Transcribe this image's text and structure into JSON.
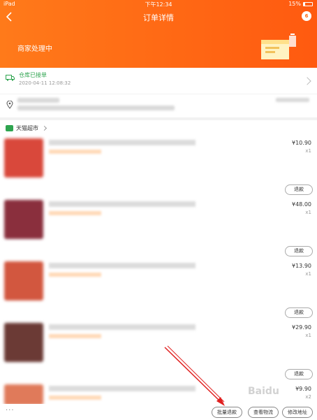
{
  "status_bar": {
    "carrier": "iPad",
    "time": "下午12:34",
    "battery": "15%"
  },
  "header": {
    "title": "订单详情",
    "back_icon": "chevron-left-icon",
    "more_badge": "6",
    "status": "商家处理中"
  },
  "logistics": {
    "title": "仓库已接单",
    "time": "2020-04-11 12:08:32"
  },
  "shop": {
    "name": "天猫超市"
  },
  "items": [
    {
      "price": "¥10.90",
      "qty": "x1",
      "refund": "退款",
      "color": "#d9483b"
    },
    {
      "price": "¥48.00",
      "qty": "x1",
      "refund": "退款",
      "color": "#8a2f3d"
    },
    {
      "price": "¥13.90",
      "qty": "x1",
      "refund": "退款",
      "color": "#d2573f"
    },
    {
      "price": "¥29.90",
      "qty": "x1",
      "refund": "退款",
      "color": "#6b3a35"
    },
    {
      "price": "¥9.90",
      "qty": "x2",
      "refund": "",
      "color": "#e07a5a"
    }
  ],
  "bottom": {
    "more": "···",
    "batch_refund": "批量退款",
    "logistics": "查看物流",
    "modify_address": "修改地址"
  },
  "watermark": "Baidu"
}
